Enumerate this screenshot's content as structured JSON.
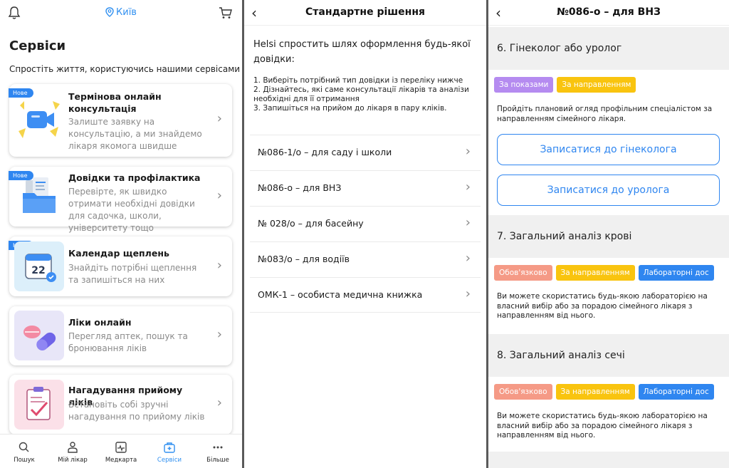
{
  "screen1": {
    "city": "Київ",
    "title": "Сервіси",
    "subtitle": "Спростіть життя, користуючись нашими сервісами",
    "cards": [
      {
        "badge": "Нове",
        "title": "Термінова онлайн консультація",
        "desc": "Залиште заявку на консультацію, а ми знайдемо лікаря якомога швидше",
        "icon": "video-call-icon"
      },
      {
        "badge": "Нове",
        "title": "Довідки та профілактика",
        "desc": "Перевірте, як швидко отримати необхідні довідки для садочка, школи, університету тощо",
        "icon": "folder-documents-icon"
      },
      {
        "badge": "Нове",
        "title": "Календар щеплень",
        "desc": "Знайдіть потрібні щеплення та запишіться на них",
        "icon": "calendar-icon"
      },
      {
        "badge": "",
        "title": "Ліки онлайн",
        "desc": "Перегляд аптек, пошук та бронювання ліків",
        "icon": "pills-icon"
      },
      {
        "badge": "",
        "title": "Нагадування прийому ліків",
        "desc": "Встановіть собі зручні нагадування по прийому ліків",
        "icon": "clipboard-check-icon"
      }
    ],
    "tabs": [
      "Пошук",
      "Мій лікар",
      "Медкарта",
      "Сервіси",
      "Більше"
    ],
    "active_tab": "Сервіси"
  },
  "screen2": {
    "title": "Стандартне рішення",
    "lead": "Helsi спростить шлях оформлення будь-якої довідки:",
    "steps": [
      "1. Виберіть потрібний тип довідки із переліку нижче",
      "2. Дізнайтесь, які саме консультації лікарів та аналізи необхідні для її отримання",
      "3. Запишіться на прийом до лікаря в пару кліків."
    ],
    "items": [
      "№086-1/о – для саду і школи",
      "№086-о – для ВНЗ",
      "№ 028/о – для басейну",
      "№083/о – для водіїв",
      "ОМК-1 – особиста медична книжка"
    ]
  },
  "screen3": {
    "title": "№086-о – для ВНЗ",
    "sections": [
      {
        "heading": "6. Гінеколог або уролог",
        "tags": [
          "За показами",
          "За направленням"
        ],
        "text": "Пройдіть плановий огляд профільним спеціалістом за направленням сімейного лікаря.",
        "buttons": [
          "Записатися до гінеколога",
          "Записатися до уролога"
        ]
      },
      {
        "heading": "7. Загальний аналіз крові",
        "tags": [
          "Обов'язково",
          "За направленням",
          "Лабораторні дос"
        ],
        "text": "Ви можете скористатись будь-якою лабораторією на власний вибір або за порадою сімейного лікаря з направленням від нього."
      },
      {
        "heading": "8. Загальний аналіз сечі",
        "tags": [
          "Обов'язково",
          "За направленням",
          "Лабораторні дос"
        ],
        "text": "Ви можете скористатись будь-якою лабораторією на власний вибір або за порадою сімейного лікаря з направленням від нього."
      }
    ]
  },
  "colors": {
    "accent": "#2f8ff0",
    "tag_violet": "#b58bf0",
    "tag_yellow": "#f9c40f",
    "tag_salmon": "#f59a86",
    "tag_blue": "#2f86f0"
  }
}
